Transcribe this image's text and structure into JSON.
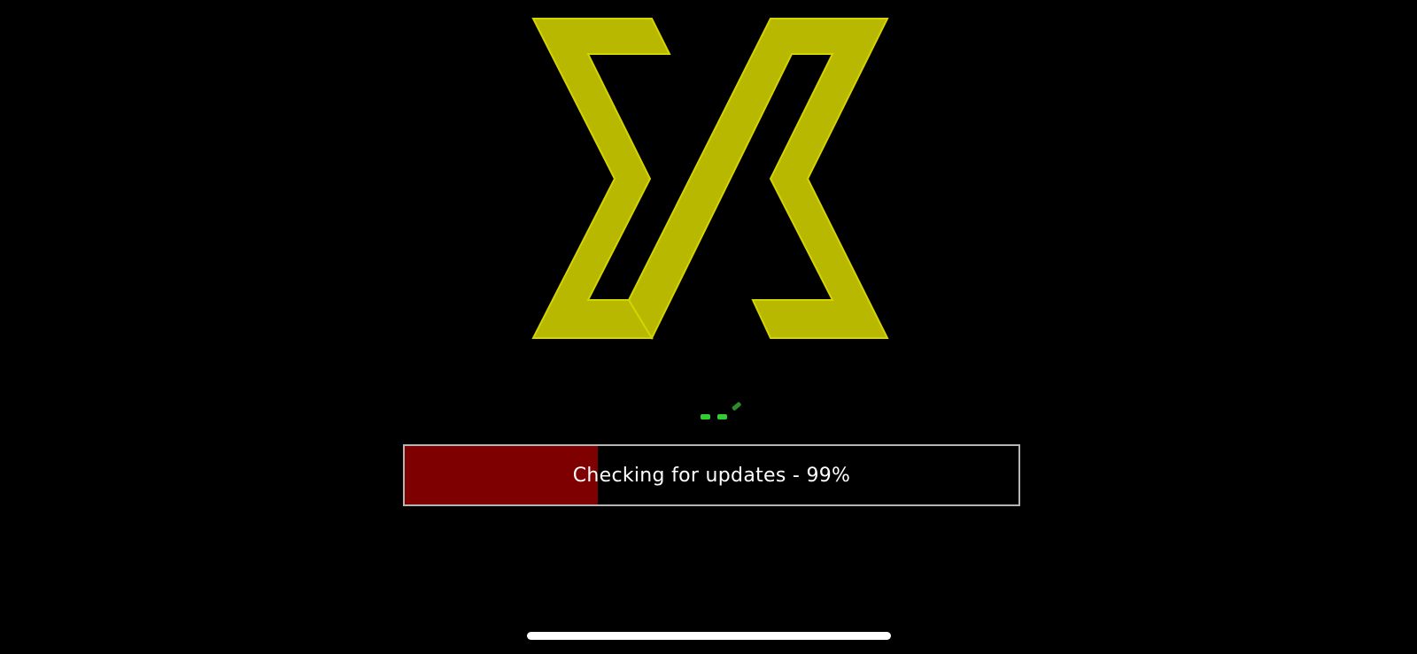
{
  "splash": {
    "logo_icon": "sigma-lambda-x-logo",
    "logo_color": "#b8b800",
    "spinner_icon": "loading-spinner-icon",
    "spinner_color": "#33cc33"
  },
  "progress": {
    "label": "Checking for updates - 99%",
    "fill_fraction": 0.315,
    "fill_color": "#7f0000",
    "border_color": "#b5b5b5"
  },
  "system": {
    "home_indicator_color": "#ffffff"
  }
}
